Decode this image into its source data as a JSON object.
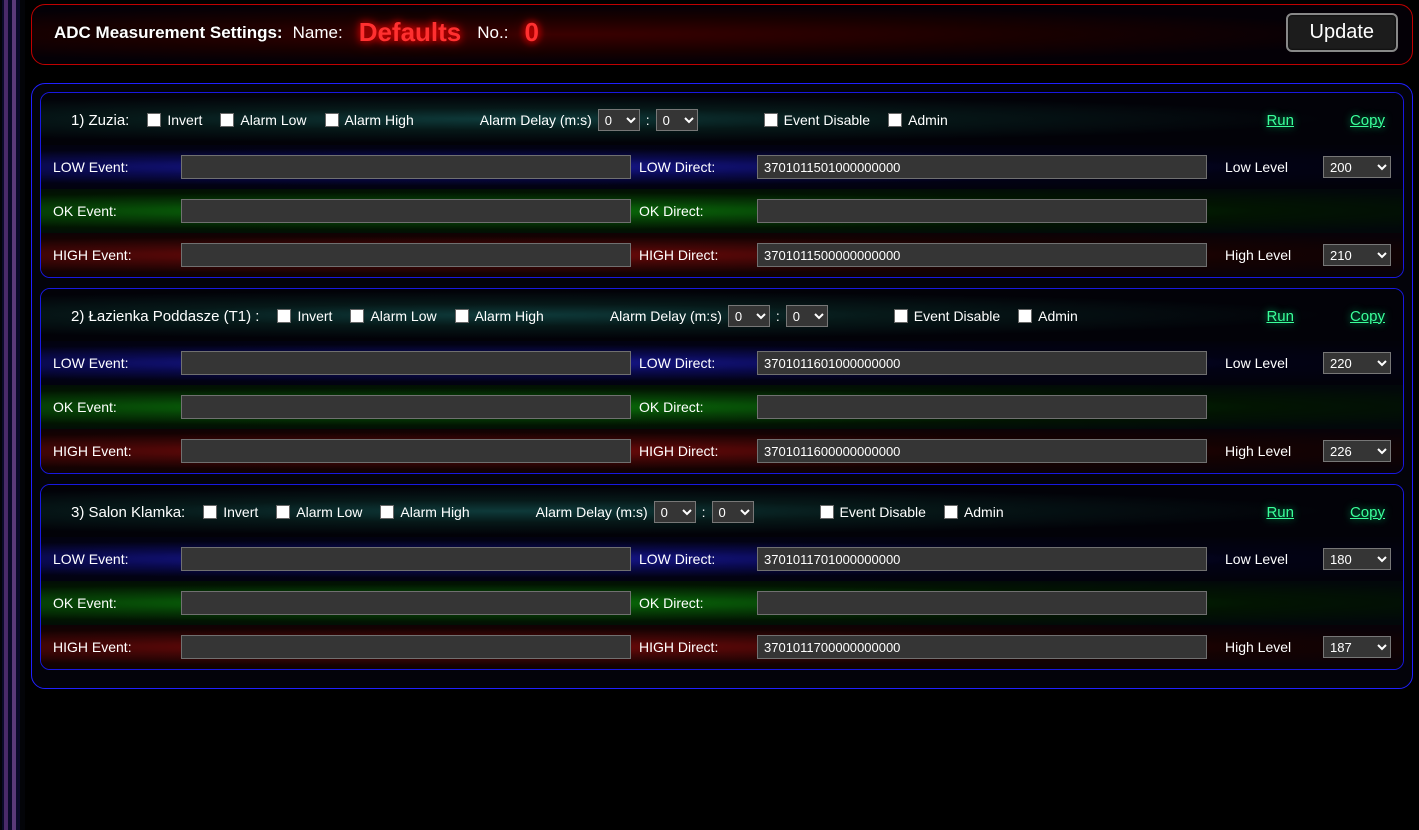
{
  "header": {
    "title": "ADC Measurement Settings:",
    "name_label": "Name:",
    "name_value": "Defaults",
    "no_label": "No.:",
    "no_value": "0",
    "update": "Update"
  },
  "labels": {
    "invert": "Invert",
    "alarm_low": "Alarm Low",
    "alarm_high": "Alarm High",
    "alarm_delay": "Alarm Delay (m:s)",
    "event_disable": "Event Disable",
    "admin": "Admin",
    "run": "Run",
    "copy": "Copy",
    "low_event": "LOW Event:",
    "low_direct": "LOW Direct:",
    "ok_event": "OK Event:",
    "ok_direct": "OK Direct:",
    "high_event": "HIGH Event:",
    "high_direct": "HIGH Direct:",
    "low_level": "Low Level",
    "high_level": "High Level",
    "colon": ":"
  },
  "channels": [
    {
      "title": "1) Zuzia:",
      "delay_m": "0",
      "delay_s": "0",
      "low_event": "",
      "low_direct": "3701011501000000000",
      "low_level": "200",
      "ok_event": "",
      "ok_direct": "",
      "high_event": "",
      "high_direct": "3701011500000000000",
      "high_level": "210"
    },
    {
      "title": "2) Łazienka Poddasze (T1) :",
      "delay_m": "0",
      "delay_s": "0",
      "low_event": "",
      "low_direct": "3701011601000000000",
      "low_level": "220",
      "ok_event": "",
      "ok_direct": "",
      "high_event": "",
      "high_direct": "3701011600000000000",
      "high_level": "226"
    },
    {
      "title": "3) Salon Klamka:",
      "delay_m": "0",
      "delay_s": "0",
      "low_event": "",
      "low_direct": "3701011701000000000",
      "low_level": "180",
      "ok_event": "",
      "ok_direct": "",
      "high_event": "",
      "high_direct": "3701011700000000000",
      "high_level": "187"
    }
  ]
}
